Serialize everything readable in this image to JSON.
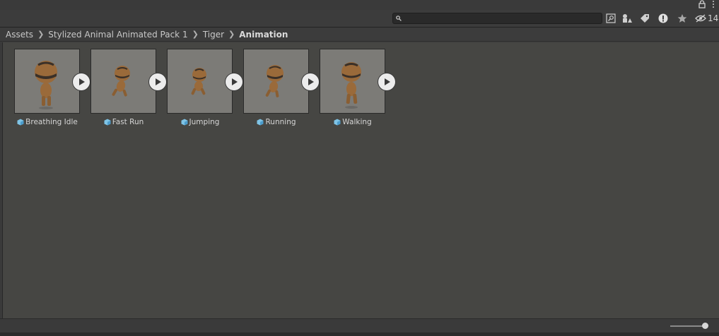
{
  "window": {
    "lock_icon": "lock-icon",
    "menu_icon": "kebab-menu-icon"
  },
  "toolbar": {
    "search": {
      "value": "",
      "placeholder": ""
    },
    "buttons": [
      "search-by-type-icon",
      "filter-by-type-icon",
      "filter-by-label-icon",
      "log-type-icon",
      "favorites-star-icon"
    ],
    "hidden_count": "14"
  },
  "breadcrumb": {
    "items": [
      "Assets",
      "Stylized Animal Animated Pack 1",
      "Tiger"
    ],
    "current": "Animation"
  },
  "assets": [
    {
      "label": "Breathing Idle"
    },
    {
      "label": "Fast Run"
    },
    {
      "label": "Jumping"
    },
    {
      "label": "Running"
    },
    {
      "label": "Walking"
    }
  ],
  "colors": {
    "panel_bg": "#464643",
    "thumb_bg": "#7c7b77",
    "character": "#9a6a3a"
  },
  "zoom_slider": {
    "value": 1.0
  }
}
